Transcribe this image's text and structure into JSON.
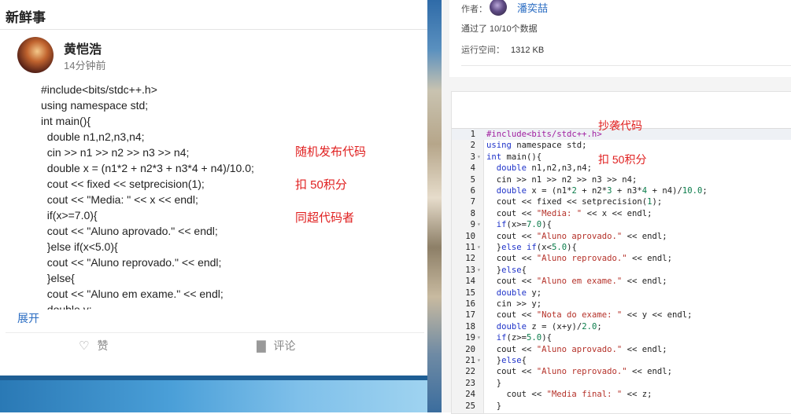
{
  "feed": {
    "title": "新鲜事",
    "post": {
      "user_name": "黄恺浩",
      "time": "14分钟前",
      "code_lines": [
        "#include<bits/stdc++.h>",
        "using namespace std;",
        "int main(){",
        "  double n1,n2,n3,n4;",
        "  cin >> n1 >> n2 >> n3 >> n4;",
        "  double x = (n1*2 + n2*3 + n3*4 + n4)/10.0;",
        "  cout << fixed << setprecision(1);",
        "  cout << \"Media: \" << x << endl;",
        "  if(x>=7.0){",
        "  cout << \"Aluno aprovado.\" << endl;",
        "  }else if(x<5.0){",
        "  cout << \"Aluno reprovado.\" << endl;",
        "  }else{",
        "  cout << \"Aluno em exame.\" << endl;",
        "  double y;"
      ],
      "notes": [
        "随机发布代码",
        "扣 50积分",
        "同超代码者"
      ],
      "expand_label": "展开",
      "like_label": "赞",
      "comment_label": "评论"
    }
  },
  "submission": {
    "author_label": "作者：",
    "author_name": "潘奕喆",
    "test_result": "通过了 10/10个数据",
    "space_label": "运行空间：",
    "space_value": "1312 KB",
    "notes": [
      "抄袭代码",
      "扣 50积分"
    ],
    "code": [
      {
        "n": "1",
        "fold": "",
        "t": [
          [
            "inc",
            "#include<bits/stdc++.h>"
          ]
        ]
      },
      {
        "n": "2",
        "fold": "",
        "t": [
          [
            "kw",
            "using"
          ],
          [
            "plain",
            " namespace std;"
          ]
        ]
      },
      {
        "n": "3",
        "fold": "▾",
        "t": [
          [
            "kw",
            "int"
          ],
          [
            "plain",
            " main(){"
          ]
        ]
      },
      {
        "n": "4",
        "fold": "",
        "t": [
          [
            "plain",
            "  "
          ],
          [
            "kw",
            "double"
          ],
          [
            "plain",
            " n1,n2,n3,n4;"
          ]
        ]
      },
      {
        "n": "5",
        "fold": "",
        "t": [
          [
            "plain",
            "  cin >> n1 >> n2 >> n3 >> n4;"
          ]
        ]
      },
      {
        "n": "6",
        "fold": "",
        "t": [
          [
            "plain",
            "  "
          ],
          [
            "kw",
            "double"
          ],
          [
            "plain",
            " x = (n1*"
          ],
          [
            "num",
            "2"
          ],
          [
            "plain",
            " + n2*"
          ],
          [
            "num",
            "3"
          ],
          [
            "plain",
            " + n3*"
          ],
          [
            "num",
            "4"
          ],
          [
            "plain",
            " + n4)/"
          ],
          [
            "num",
            "10.0"
          ],
          [
            "plain",
            ";"
          ]
        ]
      },
      {
        "n": "7",
        "fold": "",
        "t": [
          [
            "plain",
            "  cout << fixed << setprecision("
          ],
          [
            "num",
            "1"
          ],
          [
            "plain",
            ");"
          ]
        ]
      },
      {
        "n": "8",
        "fold": "",
        "t": [
          [
            "plain",
            "  cout << "
          ],
          [
            "str",
            "\"Media: \""
          ],
          [
            "plain",
            " << x << endl;"
          ]
        ]
      },
      {
        "n": "9",
        "fold": "▾",
        "t": [
          [
            "plain",
            "  "
          ],
          [
            "kw",
            "if"
          ],
          [
            "plain",
            "(x>="
          ],
          [
            "num",
            "7.0"
          ],
          [
            "plain",
            "){"
          ]
        ]
      },
      {
        "n": "10",
        "fold": "",
        "t": [
          [
            "plain",
            "  cout << "
          ],
          [
            "str",
            "\"Aluno aprovado.\""
          ],
          [
            "plain",
            " << endl;"
          ]
        ]
      },
      {
        "n": "11",
        "fold": "▾",
        "t": [
          [
            "plain",
            "  }"
          ],
          [
            "kw",
            "else if"
          ],
          [
            "plain",
            "(x<"
          ],
          [
            "num",
            "5.0"
          ],
          [
            "plain",
            "){"
          ]
        ]
      },
      {
        "n": "12",
        "fold": "",
        "t": [
          [
            "plain",
            "  cout << "
          ],
          [
            "str",
            "\"Aluno reprovado.\""
          ],
          [
            "plain",
            " << endl;"
          ]
        ]
      },
      {
        "n": "13",
        "fold": "▾",
        "t": [
          [
            "plain",
            "  }"
          ],
          [
            "kw",
            "else"
          ],
          [
            "plain",
            "{"
          ]
        ]
      },
      {
        "n": "14",
        "fold": "",
        "t": [
          [
            "plain",
            "  cout << "
          ],
          [
            "str",
            "\"Aluno em exame.\""
          ],
          [
            "plain",
            " << endl;"
          ]
        ]
      },
      {
        "n": "15",
        "fold": "",
        "t": [
          [
            "plain",
            "  "
          ],
          [
            "kw",
            "double"
          ],
          [
            "plain",
            " y;"
          ]
        ]
      },
      {
        "n": "16",
        "fold": "",
        "t": [
          [
            "plain",
            "  cin >> y;"
          ]
        ]
      },
      {
        "n": "17",
        "fold": "",
        "t": [
          [
            "plain",
            "  cout << "
          ],
          [
            "str",
            "\"Nota do exame: \""
          ],
          [
            "plain",
            " << y << endl;"
          ]
        ]
      },
      {
        "n": "18",
        "fold": "",
        "t": [
          [
            "plain",
            "  "
          ],
          [
            "kw",
            "double"
          ],
          [
            "plain",
            " z = (x+y)/"
          ],
          [
            "num",
            "2.0"
          ],
          [
            "plain",
            ";"
          ]
        ]
      },
      {
        "n": "19",
        "fold": "▾",
        "t": [
          [
            "plain",
            "  "
          ],
          [
            "kw",
            "if"
          ],
          [
            "plain",
            "(z>="
          ],
          [
            "num",
            "5.0"
          ],
          [
            "plain",
            "){"
          ]
        ]
      },
      {
        "n": "20",
        "fold": "",
        "t": [
          [
            "plain",
            "  cout << "
          ],
          [
            "str",
            "\"Aluno aprovado.\""
          ],
          [
            "plain",
            " << endl;"
          ]
        ]
      },
      {
        "n": "21",
        "fold": "▾",
        "t": [
          [
            "plain",
            "  }"
          ],
          [
            "kw",
            "else"
          ],
          [
            "plain",
            "{"
          ]
        ]
      },
      {
        "n": "22",
        "fold": "",
        "t": [
          [
            "plain",
            "  cout << "
          ],
          [
            "str",
            "\"Aluno reprovado.\""
          ],
          [
            "plain",
            " << endl;"
          ]
        ]
      },
      {
        "n": "23",
        "fold": "",
        "t": [
          [
            "plain",
            "  }"
          ]
        ]
      },
      {
        "n": "24",
        "fold": "",
        "t": [
          [
            "plain",
            "    cout << "
          ],
          [
            "str",
            "\"Media final: \""
          ],
          [
            "plain",
            " << z;"
          ]
        ]
      },
      {
        "n": "25",
        "fold": "",
        "t": [
          [
            "plain",
            "  }"
          ]
        ]
      }
    ]
  },
  "icons": {
    "like": "heart-icon",
    "comment": "comment-icon",
    "fold": "chevron-down-icon"
  },
  "colors": {
    "note_red": "#e02020",
    "link_blue": "#2a6cc2",
    "keyword": "#1f33c9",
    "include": "#a01fa0",
    "string": "#b5322a",
    "number": "#0a7c4a"
  }
}
